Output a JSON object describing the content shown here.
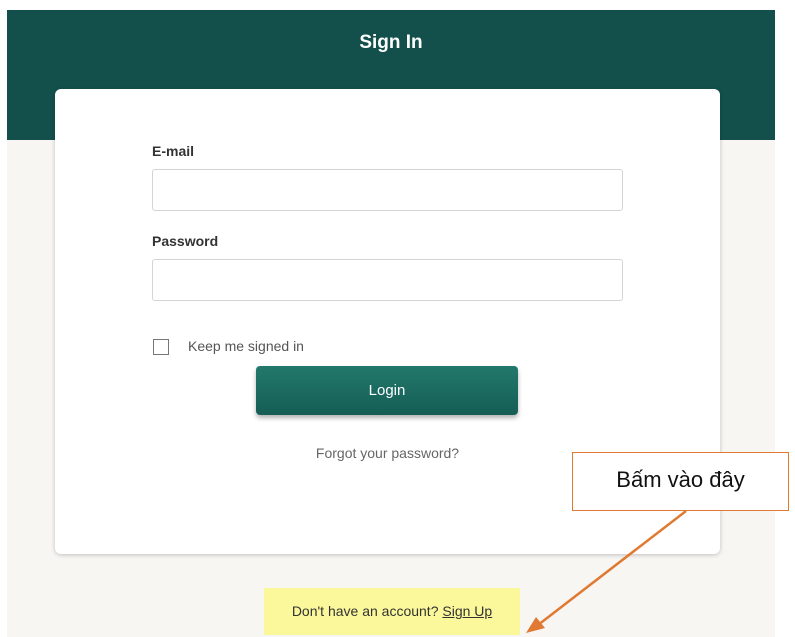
{
  "header": {
    "title": "Sign In"
  },
  "form": {
    "email_label": "E-mail",
    "email_value": "",
    "password_label": "Password",
    "password_value": "",
    "remember_label": "Keep me signed in",
    "remember_checked": false,
    "login_label": "Login",
    "forgot_label": "Forgot your password?"
  },
  "footer": {
    "prompt": "Don't have an account?",
    "signup_label": "Sign Up"
  },
  "annotation": {
    "callout_text": "Bấm vào đây"
  },
  "colors": {
    "header_bg": "#13504b",
    "button_bg": "#1d6f65",
    "highlight": "#fbf89c",
    "callout_border": "#e07a33"
  }
}
